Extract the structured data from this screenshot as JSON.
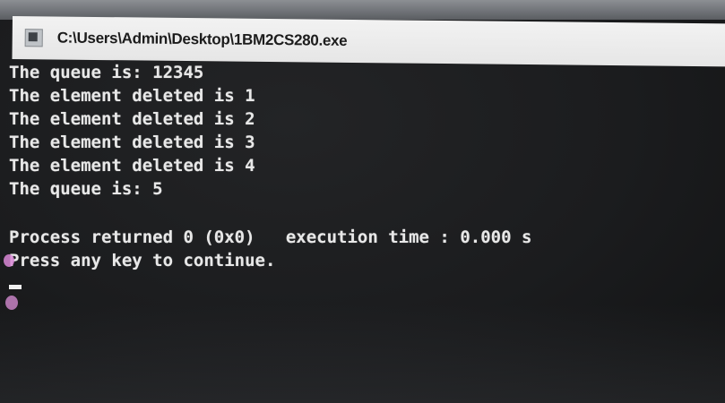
{
  "window": {
    "title": "C:\\Users\\Admin\\Desktop\\1BM2CS280.exe",
    "icon": "console-app-icon"
  },
  "console": {
    "lines": [
      "The queue is: 12345",
      "The element deleted is 1",
      "The element deleted is 2",
      "The element deleted is 3",
      "The element deleted is 4",
      "The queue is: 5",
      "",
      "Process returned 0 (0x0)   execution time : 0.000 s",
      "Press any key to continue."
    ]
  },
  "colors": {
    "console_background": "#1b1c1e",
    "console_text": "#e8e8e8",
    "titlebar_background": "#eeeeee"
  }
}
